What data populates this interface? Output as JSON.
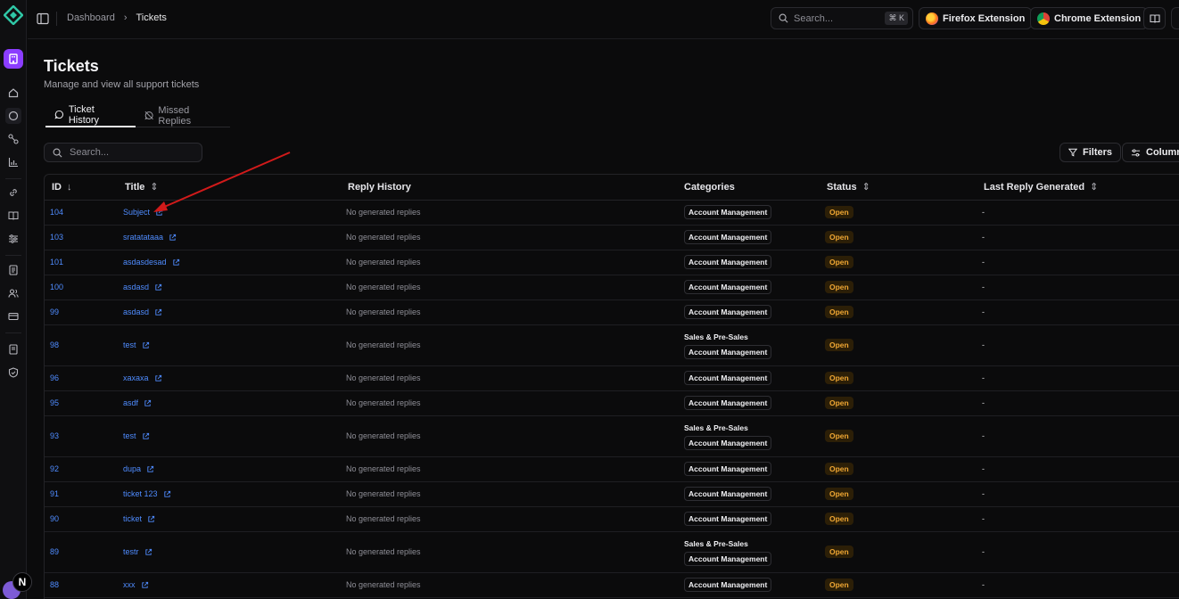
{
  "breadcrumb": {
    "root": "Dashboard",
    "current": "Tickets"
  },
  "topbar": {
    "search_placeholder": "Search...",
    "search_shortcut": "⌘ K",
    "firefox_label": "Firefox Extension",
    "chrome_label": "Chrome Extension"
  },
  "page": {
    "title": "Tickets",
    "subtitle": "Manage and view all support tickets"
  },
  "tabs": [
    {
      "label": "Ticket History",
      "active": true
    },
    {
      "label": "Missed Replies",
      "active": false
    }
  ],
  "table_search": {
    "placeholder": "Search..."
  },
  "toolbar": {
    "filters_label": "Filters",
    "columns_label": "Column"
  },
  "columns": [
    "ID",
    "Title",
    "Reply History",
    "Categories",
    "Status",
    "Last Reply Generated"
  ],
  "rows": [
    {
      "id": "104",
      "title": "Subject",
      "reply": "No generated replies",
      "categories": [
        "Account Management"
      ],
      "status": "Open",
      "last": "-"
    },
    {
      "id": "103",
      "title": "sratatataaa",
      "reply": "No generated replies",
      "categories": [
        "Account Management"
      ],
      "status": "Open",
      "last": "-"
    },
    {
      "id": "101",
      "title": "asdasdesad",
      "reply": "No generated replies",
      "categories": [
        "Account Management"
      ],
      "status": "Open",
      "last": "-"
    },
    {
      "id": "100",
      "title": "asdasd",
      "reply": "No generated replies",
      "categories": [
        "Account Management"
      ],
      "status": "Open",
      "last": "-"
    },
    {
      "id": "99",
      "title": "asdasd",
      "reply": "No generated replies",
      "categories": [
        "Account Management"
      ],
      "status": "Open",
      "last": "-"
    },
    {
      "id": "98",
      "title": "test",
      "reply": "No generated replies",
      "categories": [
        "Sales & Pre-Sales",
        "Account Management"
      ],
      "status": "Open",
      "last": "-"
    },
    {
      "id": "96",
      "title": "xaxaxa",
      "reply": "No generated replies",
      "categories": [
        "Account Management"
      ],
      "status": "Open",
      "last": "-"
    },
    {
      "id": "95",
      "title": "asdf",
      "reply": "No generated replies",
      "categories": [
        "Account Management"
      ],
      "status": "Open",
      "last": "-"
    },
    {
      "id": "93",
      "title": "test",
      "reply": "No generated replies",
      "categories": [
        "Sales & Pre-Sales",
        "Account Management"
      ],
      "status": "Open",
      "last": "-"
    },
    {
      "id": "92",
      "title": "dupa",
      "reply": "No generated replies",
      "categories": [
        "Account Management"
      ],
      "status": "Open",
      "last": "-"
    },
    {
      "id": "91",
      "title": "ticket 123",
      "reply": "No generated replies",
      "categories": [
        "Account Management"
      ],
      "status": "Open",
      "last": "-"
    },
    {
      "id": "90",
      "title": "ticket",
      "reply": "No generated replies",
      "categories": [
        "Account Management"
      ],
      "status": "Open",
      "last": "-"
    },
    {
      "id": "89",
      "title": "testr",
      "reply": "No generated replies",
      "categories": [
        "Sales & Pre-Sales",
        "Account Management"
      ],
      "status": "Open",
      "last": "-"
    },
    {
      "id": "88",
      "title": "xxx",
      "reply": "No generated replies",
      "categories": [
        "Account Management"
      ],
      "status": "Open",
      "last": "-"
    }
  ],
  "colors": {
    "accent_link": "#4f8cff",
    "status_open": "#f0a733",
    "annotation_arrow": "#d11a1a",
    "org_badge": "#8b3dff"
  },
  "user_badge": "N"
}
